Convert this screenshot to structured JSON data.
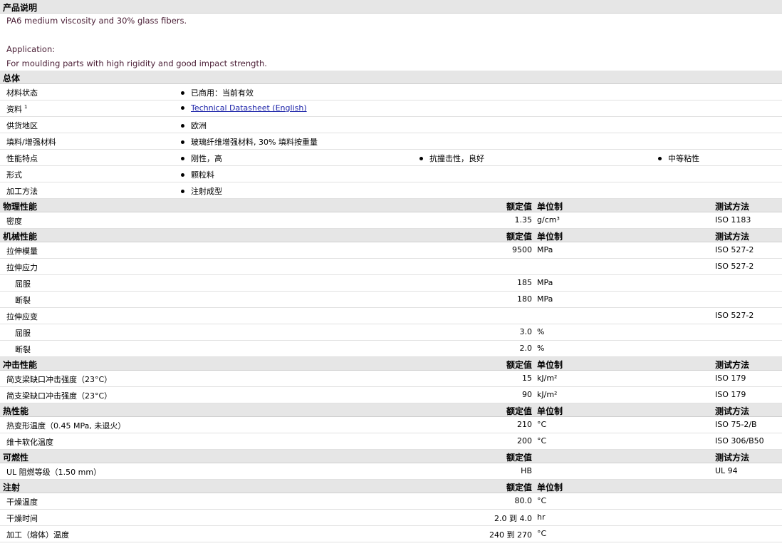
{
  "description": {
    "title": "产品说明",
    "line1": "PA6 medium viscosity and 30% glass fibers.",
    "line2": "Application:",
    "line3": "For moulding parts with high rigidity and good impact strength."
  },
  "general": {
    "title": "总体",
    "rows": [
      {
        "label": "材料状态",
        "items": [
          "已商用：当前有效"
        ]
      },
      {
        "label": "资料",
        "sup": "1",
        "link": "Technical Datasheet (English)"
      },
      {
        "label": "供货地区",
        "items": [
          "欧洲"
        ]
      },
      {
        "label": "填料/增强材料",
        "items": [
          "玻璃纤维增强材料, 30% 填料按重量"
        ]
      },
      {
        "label": "性能特点",
        "items": [
          "刚性，高",
          "抗撞击性，良好",
          "中等粘性"
        ]
      },
      {
        "label": "形式",
        "items": [
          "颗粒料"
        ]
      },
      {
        "label": "加工方法",
        "items": [
          "注射成型"
        ]
      }
    ]
  },
  "columns": {
    "nominal": "额定值",
    "unit": "单位制",
    "method": "测试方法"
  },
  "physical": {
    "title": "物理性能",
    "rows": [
      {
        "label": "密度",
        "value": "1.35",
        "unit": "g/cm³",
        "method": "ISO 1183"
      }
    ]
  },
  "mechanical": {
    "title": "机械性能",
    "rows": [
      {
        "label": "拉伸模量",
        "value": "9500",
        "unit": "MPa",
        "method": "ISO 527-2"
      },
      {
        "label": "拉伸应力",
        "value": "",
        "unit": "",
        "method": "ISO 527-2"
      },
      {
        "label": "屈服",
        "sub": true,
        "value": "185",
        "unit": "MPa",
        "method": ""
      },
      {
        "label": "断裂",
        "sub": true,
        "value": "180",
        "unit": "MPa",
        "method": ""
      },
      {
        "label": "拉伸应变",
        "value": "",
        "unit": "",
        "method": "ISO 527-2"
      },
      {
        "label": "屈服",
        "sub": true,
        "value": "3.0",
        "unit": "%",
        "method": ""
      },
      {
        "label": "断裂",
        "sub": true,
        "value": "2.0",
        "unit": "%",
        "method": ""
      }
    ]
  },
  "impact": {
    "title": "冲击性能",
    "rows": [
      {
        "label": "简支梁缺口冲击强度（23°C）",
        "value": "15",
        "unit": "kJ/m²",
        "method": "ISO 179"
      },
      {
        "label": "简支梁缺口冲击强度（23°C）",
        "value": "90",
        "unit": "kJ/m²",
        "method": "ISO 179"
      }
    ]
  },
  "thermal": {
    "title": "热性能",
    "rows": [
      {
        "label": "热变形温度（0.45 MPa, 未退火）",
        "value": "210",
        "unit": "°C",
        "method": "ISO 75-2/B"
      },
      {
        "label": "维卡软化温度",
        "value": "200",
        "unit": "°C",
        "method": "ISO 306/B50"
      }
    ]
  },
  "flammability": {
    "title": "可燃性",
    "rows": [
      {
        "label": "UL 阻燃等级（1.50 mm）",
        "value": "HB",
        "unit": "",
        "method": "UL 94"
      }
    ]
  },
  "injection": {
    "title": "注射",
    "rows": [
      {
        "label": "干燥温度",
        "value": "80.0",
        "unit": "°C",
        "method": ""
      },
      {
        "label": "干燥时间",
        "value": "2.0 到  4.0",
        "unit": "hr",
        "method": ""
      },
      {
        "label": "加工（熔体）温度",
        "value": "240 到  270",
        "unit": "°C",
        "method": ""
      }
    ]
  }
}
